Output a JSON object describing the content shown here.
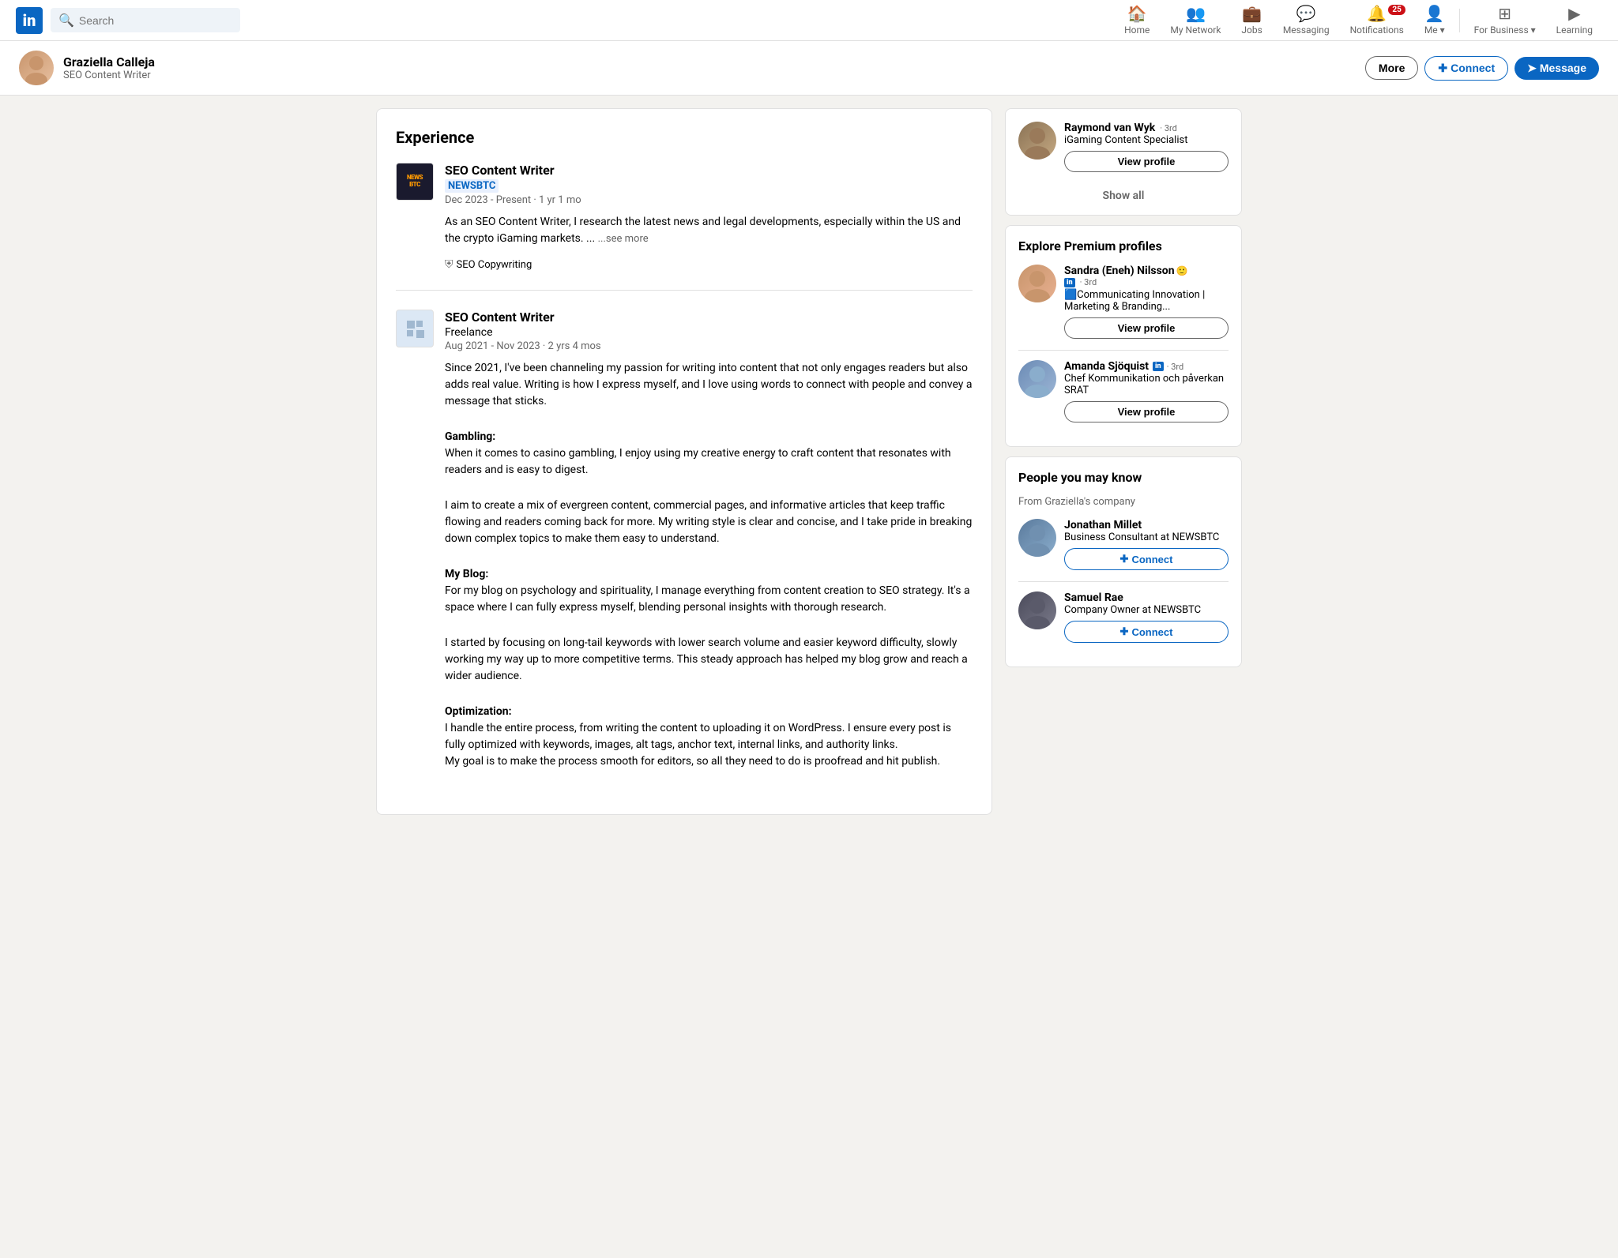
{
  "navbar": {
    "logo_text": "in",
    "search_placeholder": "Search",
    "nav_items": [
      {
        "id": "home",
        "label": "Home",
        "icon": "🏠"
      },
      {
        "id": "my-network",
        "label": "My Network",
        "icon": "👥"
      },
      {
        "id": "jobs",
        "label": "Jobs",
        "icon": "💼"
      },
      {
        "id": "messaging",
        "label": "Messaging",
        "icon": "💬"
      },
      {
        "id": "notifications",
        "label": "Notifications",
        "icon": "🔔",
        "badge": "25"
      },
      {
        "id": "me",
        "label": "Me ▾",
        "icon": "👤"
      }
    ],
    "for_business_label": "For Business ▾",
    "learning_label": "Learning"
  },
  "profile_bar": {
    "name": "Graziella Calleja",
    "title": "SEO Content Writer",
    "more_label": "More",
    "connect_label": "Connect",
    "message_label": "Message"
  },
  "experience_section": {
    "title": "Experience",
    "items": [
      {
        "id": "newsbtc",
        "job_title": "SEO Content Writer",
        "company": "NEWSBTC",
        "company_highlighted": true,
        "dates": "Dec 2023 - Present · 1 yr 1 mo",
        "description": "As an SEO Content Writer, I research the latest news and legal developments, especially within the US and the crypto iGaming markets. ...",
        "see_more": "...see more",
        "skill": "SEO Copywriting",
        "logo_type": "newsbtc"
      },
      {
        "id": "freelance",
        "job_title": "SEO Content Writer",
        "company": "Freelance",
        "company_highlighted": false,
        "dates": "Aug 2021 - Nov 2023 · 2 yrs 4 mos",
        "description_paragraphs": [
          "Since 2021, I've been channeling my passion for writing into content that not only engages readers but also adds real value. Writing is how I express myself, and I love using words to connect with people and convey a message that sticks.",
          "Gambling:\nWhen it comes to casino gambling, I enjoy using my creative energy to craft content that resonates with readers and is easy to digest.",
          "I aim to create a mix of evergreen content, commercial pages, and informative articles that keep traffic flowing and readers coming back for more. My writing style is clear and concise, and I take pride in breaking down complex topics to make them easy to understand.",
          "My Blog:\nFor my blog on psychology and spirituality, I manage everything from content creation to SEO strategy. It's a space where I can fully express myself, blending personal insights with thorough research.",
          "I started by focusing on long-tail keywords with lower search volume and easier keyword difficulty, slowly working my way up to more competitive terms. This steady approach has helped my blog grow and reach a wider audience.",
          "Optimization:\nI handle the entire process, from writing the content to uploading it on WordPress. I ensure every post is fully optimized with keywords, images, alt tags, anchor text, internal links, and authority links.\nMy goal is to make the process smooth for editors, so all they need to do is proofread and hit publish."
        ],
        "logo_type": "freelance"
      }
    ]
  },
  "sidebar": {
    "also_viewed_card": {
      "raymond": {
        "name": "Raymond van Wyk",
        "degree": "3rd",
        "title": "iGaming Content Specialist",
        "view_profile_label": "View profile"
      },
      "show_all_label": "Show all"
    },
    "premium_card": {
      "title": "Explore Premium profiles",
      "people": [
        {
          "id": "sandra",
          "name": "Sandra (Eneh) Nilsson",
          "degree": "3rd",
          "has_premium": true,
          "has_open_to_work": true,
          "title": "🟦Communicating Innovation | Marketing & Branding...",
          "view_profile_label": "View profile"
        },
        {
          "id": "amanda",
          "name": "Amanda Sjöquist",
          "degree": "3rd",
          "has_premium": true,
          "title": "Chef Kommunikation och påverkan SRAT",
          "view_profile_label": "View profile"
        }
      ]
    },
    "people_know_card": {
      "title": "People you may know",
      "subtitle": "From Graziella's company",
      "people": [
        {
          "id": "jonathan",
          "name": "Jonathan Millet",
          "title": "Business Consultant at NEWSBTC",
          "connect_label": "Connect"
        },
        {
          "id": "samuel",
          "name": "Samuel Rae",
          "title": "Company Owner at NEWSBTC",
          "connect_label": "Connect"
        }
      ]
    }
  }
}
